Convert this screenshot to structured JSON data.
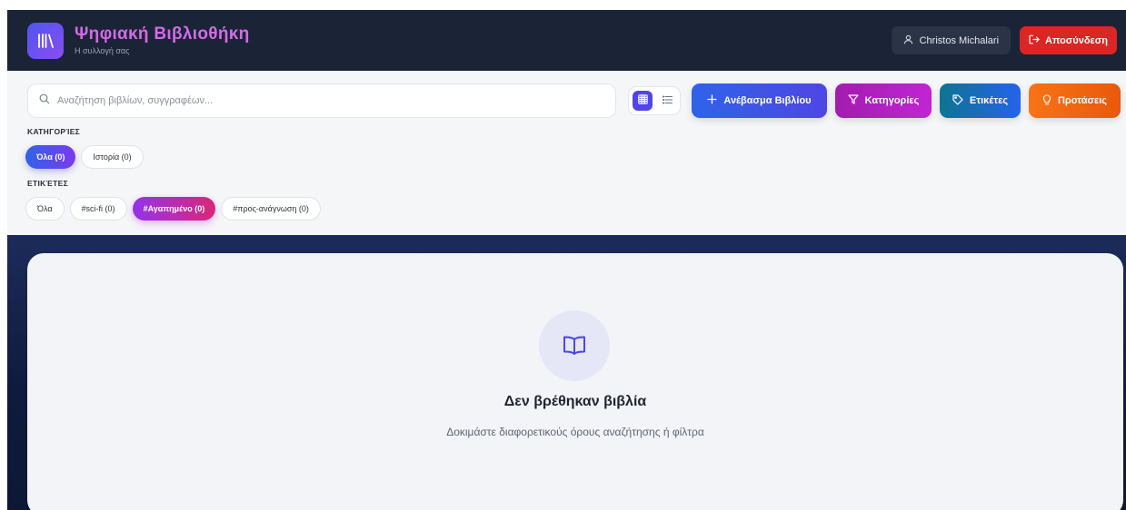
{
  "header": {
    "app_title": "Ψηφιακή Βιβλιοθήκη",
    "app_subtitle": "Η συλλογή σας",
    "user_name": "Christos Michalari",
    "logout_label": "Αποσύνδεση",
    "logo_icon": "library-icon",
    "colors": {
      "bar_bg": "#1b2436",
      "title": "#d26be6",
      "logout": "#dc2626"
    }
  },
  "toolbar": {
    "search_placeholder": "Αναζήτηση βιβλίων, συγγραφέων...",
    "view_mode": "grid",
    "buttons": {
      "upload": "Ανέβασμα Βιβλίου",
      "categories": "Κατηγορίες",
      "tags": "Ετικέτες",
      "suggestions": "Προτάσεις"
    }
  },
  "filters": {
    "categories_label": "ΚΑΤΗΓΟΡΊΕΣ",
    "categories": [
      {
        "label": "Όλα (0)",
        "active": true
      },
      {
        "label": "Ιστορία (0)",
        "active": false
      }
    ],
    "tags_label": "ΕΤΙΚΈΤΕΣ",
    "tags": [
      {
        "label": "Όλα",
        "active": false
      },
      {
        "label": "#sci-fi (0)",
        "active": false
      },
      {
        "label": "#Αγαπημένο (0)",
        "active": true
      },
      {
        "label": "#προς-ανάγνωση (0)",
        "active": false
      }
    ]
  },
  "empty_state": {
    "icon": "open-book-icon",
    "title": "Δεν βρέθηκαν βιβλία",
    "subtitle": "Δοκιμάστε διαφορετικούς όρους αναζήτησης ή φίλτρα"
  }
}
